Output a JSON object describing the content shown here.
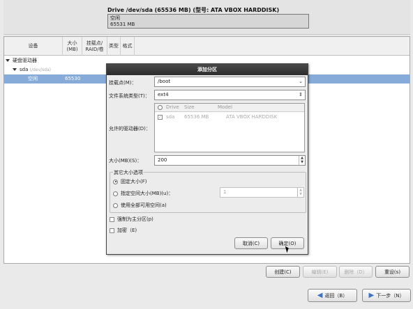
{
  "drive": {
    "title": "Drive /dev/sda (65536 MB) (型号: ATA VBOX HARDDISK)",
    "bar_label": "空闲",
    "bar_size": "65531 MB"
  },
  "table": {
    "headers": [
      "设备",
      "大小\n(MB)",
      "挂载点/\nRAID/卷",
      "类型",
      "格式"
    ],
    "group_label": "硬盘驱动器",
    "disk_name": "sda",
    "disk_path": "(/dev/sda)",
    "free_label": "空闲",
    "free_size": "65530"
  },
  "buttons": {
    "create": "创建(C)",
    "edit": "编辑(E)",
    "delete": "删除（D）",
    "reset": "重设(s)",
    "back": "返回（B）",
    "next": "下一步（N）"
  },
  "dialog": {
    "title": "添加分区",
    "mount_label": "挂载点(M)：",
    "mount_value": "/boot",
    "fs_label": "文件系统类型(T)：",
    "fs_value": "ext4",
    "drives_label": "允许的驱动器(D)：",
    "drive_columns": [
      "Drive",
      "Size",
      "Model"
    ],
    "drive_rows": [
      {
        "drive": "sda",
        "size": "65536 MB",
        "model": "ATA VBOX HARDDISK"
      }
    ],
    "size_label": "大小(MB)(S)：",
    "size_value": "200",
    "other_options_label": "其它大小选项",
    "opt_fixed": "固定大小(F)",
    "opt_upto": "指定空间大小(MB)(u)：",
    "opt_upto_value": "1",
    "opt_fill": "使用全部可用空间(a)",
    "force_primary": "强制为主分区(p)",
    "encrypt": "加密（E)",
    "cancel": "取消(C)",
    "ok": "确定(O)"
  },
  "colors": {
    "selection": "#86abd9",
    "dialog_title_bg": "#2c2c2c",
    "nav_arrow": "#3a73c7"
  }
}
